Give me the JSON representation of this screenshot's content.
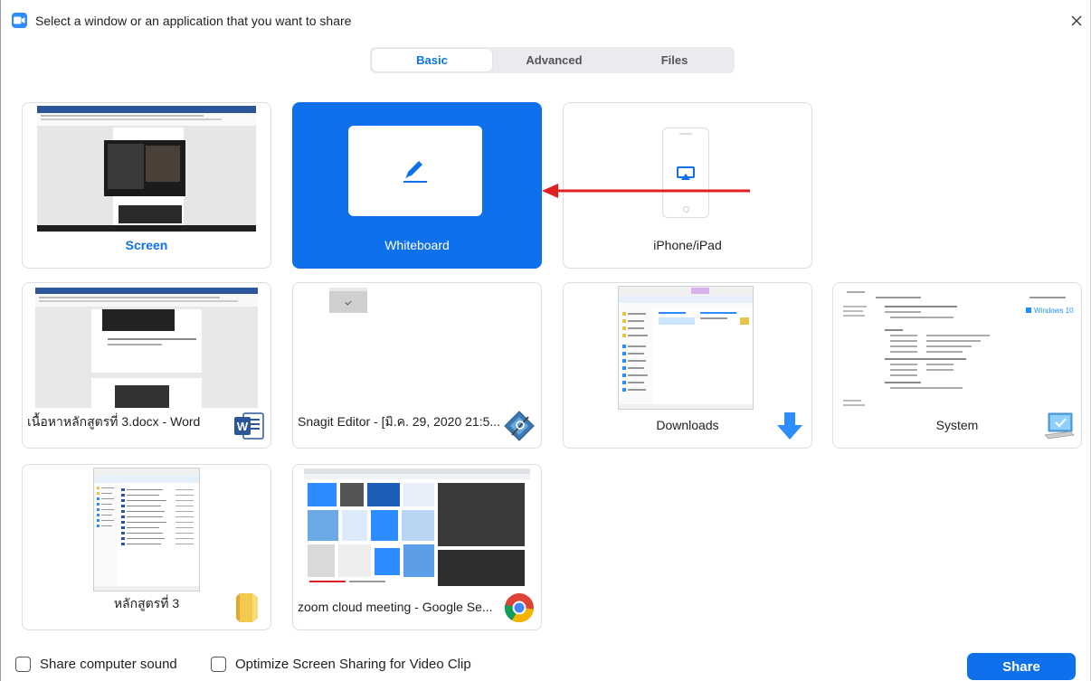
{
  "window": {
    "title": "Select a window or an application that you want to share",
    "close_icon": "close-icon"
  },
  "tabs": [
    {
      "label": "Basic",
      "active": true
    },
    {
      "label": "Advanced",
      "active": false
    },
    {
      "label": "Files",
      "active": false
    }
  ],
  "cards": {
    "screen": {
      "label": "Screen"
    },
    "whiteboard": {
      "label": "Whiteboard",
      "icon": "pen-icon"
    },
    "iphone_ipad": {
      "label": "iPhone/iPad",
      "icon": "airplay-icon"
    },
    "word_doc": {
      "label": "เนื้อหาหลักสูตรที่ 3.docx - Word",
      "icon": "word-icon"
    },
    "snagit": {
      "label": "Snagit Editor - [มิ.ค. 29, 2020 21:5...",
      "icon": "snagit-icon"
    },
    "downloads": {
      "label": "Downloads",
      "icon": "download-arrow-icon"
    },
    "system": {
      "label": "System",
      "icon": "computer-icon"
    },
    "folder": {
      "label": "หลักสูตรที่ 3",
      "icon": "folder-icon"
    },
    "chrome": {
      "label": "zoom cloud meeting - Google Se...",
      "icon": "chrome-icon"
    }
  },
  "footer": {
    "share_sound_label": "Share computer sound",
    "optimize_label": "Optimize Screen Sharing for Video Clip",
    "share_button_label": "Share"
  },
  "colors": {
    "accent": "#0e71eb",
    "annotation_arrow": "#e02020"
  }
}
